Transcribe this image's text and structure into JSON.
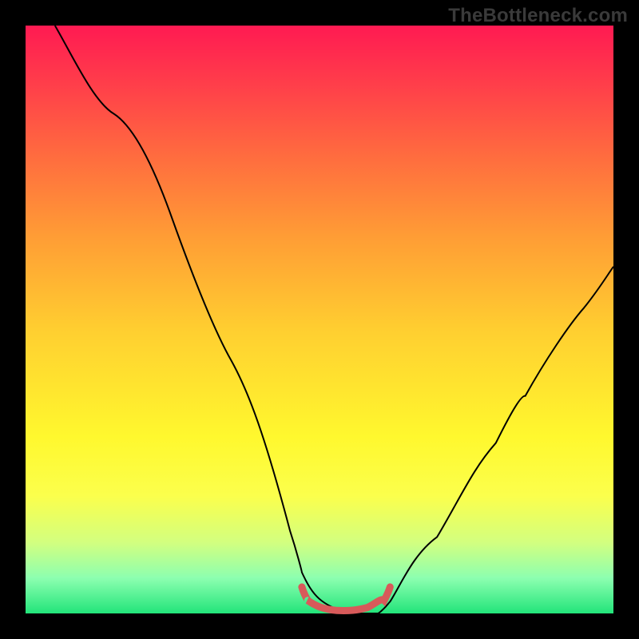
{
  "brand": {
    "watermark": "TheBottleneck.com"
  },
  "chart_data": {
    "type": "line",
    "title": "",
    "xlabel": "",
    "ylabel": "",
    "xlim": [
      0,
      100
    ],
    "ylim": [
      0,
      100
    ],
    "grid": false,
    "legend": false,
    "background": {
      "type": "vertical-gradient",
      "stops": [
        {
          "pos": 0,
          "color": "#ff1a52"
        },
        {
          "pos": 10,
          "color": "#ff3e4a"
        },
        {
          "pos": 22,
          "color": "#ff6b3f"
        },
        {
          "pos": 36,
          "color": "#ff9d35"
        },
        {
          "pos": 52,
          "color": "#ffcf30"
        },
        {
          "pos": 70,
          "color": "#fff82e"
        },
        {
          "pos": 80,
          "color": "#fbff4c"
        },
        {
          "pos": 88,
          "color": "#d2ff80"
        },
        {
          "pos": 94,
          "color": "#8cffb0"
        },
        {
          "pos": 100,
          "color": "#22e47a"
        }
      ]
    },
    "series": [
      {
        "name": "bottleneck-curve",
        "color": "#000000",
        "width": 2,
        "x": [
          5,
          10,
          15,
          20,
          25,
          30,
          35,
          40,
          45,
          47,
          50,
          55,
          60,
          62,
          65,
          70,
          75,
          80,
          85,
          90,
          95,
          100
        ],
        "y": [
          100,
          93,
          85,
          76,
          66,
          55,
          43,
          30,
          14,
          7,
          2,
          0,
          0,
          2,
          6,
          13,
          21,
          29,
          37,
          45,
          52,
          59
        ]
      },
      {
        "name": "optimal-region",
        "color": "#d85a5a",
        "width": 9,
        "linecap": "round",
        "x": [
          47,
          48,
          50,
          53,
          56,
          59,
          61,
          62
        ],
        "y": [
          4.5,
          2.2,
          1,
          0.5,
          0.5,
          1,
          2.2,
          4.5
        ]
      }
    ],
    "annotations": []
  }
}
